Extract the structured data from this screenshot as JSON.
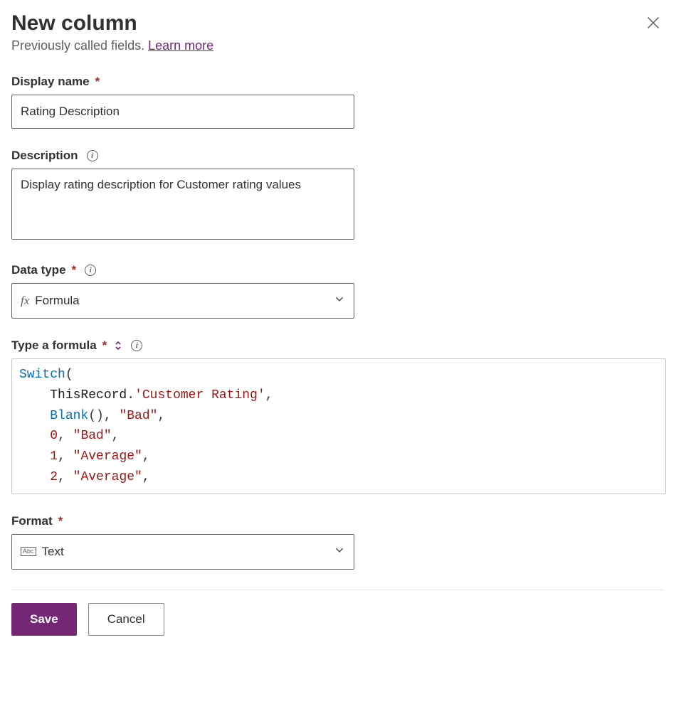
{
  "header": {
    "title": "New column",
    "subtitle_prefix": "Previously called fields. ",
    "learn_more": "Learn more"
  },
  "fields": {
    "display_name": {
      "label": "Display name",
      "value": "Rating Description"
    },
    "description": {
      "label": "Description",
      "value": "Display rating description for Customer rating values"
    },
    "data_type": {
      "label": "Data type",
      "value": "Formula"
    },
    "formula": {
      "label": "Type a formula",
      "tokens": [
        {
          "t": "func",
          "v": "Switch"
        },
        {
          "t": "punc",
          "v": "("
        },
        {
          "t": "nl"
        },
        {
          "t": "indent"
        },
        {
          "t": "ident",
          "v": "ThisRecord"
        },
        {
          "t": "punc",
          "v": "."
        },
        {
          "t": "str",
          "v": "'Customer Rating'"
        },
        {
          "t": "punc",
          "v": ","
        },
        {
          "t": "nl"
        },
        {
          "t": "indent"
        },
        {
          "t": "func",
          "v": "Blank"
        },
        {
          "t": "punc",
          "v": "()"
        },
        {
          "t": "punc",
          "v": ", "
        },
        {
          "t": "str",
          "v": "\"Bad\""
        },
        {
          "t": "punc",
          "v": ","
        },
        {
          "t": "nl"
        },
        {
          "t": "indent"
        },
        {
          "t": "num",
          "v": "0"
        },
        {
          "t": "punc",
          "v": ", "
        },
        {
          "t": "str",
          "v": "\"Bad\""
        },
        {
          "t": "punc",
          "v": ","
        },
        {
          "t": "nl"
        },
        {
          "t": "indent"
        },
        {
          "t": "num",
          "v": "1"
        },
        {
          "t": "punc",
          "v": ", "
        },
        {
          "t": "str",
          "v": "\"Average\""
        },
        {
          "t": "punc",
          "v": ","
        },
        {
          "t": "nl"
        },
        {
          "t": "indent"
        },
        {
          "t": "num",
          "v": "2"
        },
        {
          "t": "punc",
          "v": ", "
        },
        {
          "t": "str",
          "v": "\"Average\""
        },
        {
          "t": "punc",
          "v": ","
        }
      ]
    },
    "format": {
      "label": "Format",
      "value": "Text"
    }
  },
  "footer": {
    "save": "Save",
    "cancel": "Cancel"
  }
}
